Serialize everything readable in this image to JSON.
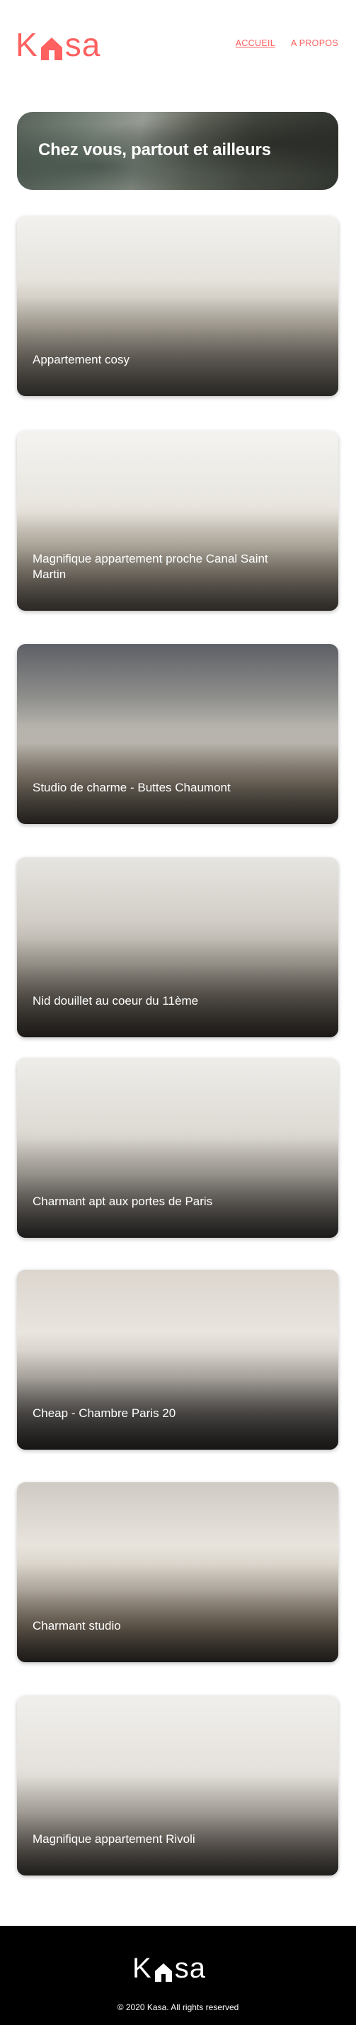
{
  "brand": {
    "name_start": "K",
    "name_end": "sa",
    "color": "#FF6060"
  },
  "nav": [
    {
      "label": "ACCUEIL",
      "active": true
    },
    {
      "label": "A PROPOS",
      "active": false
    }
  ],
  "banner": {
    "title": "Chez vous, partout et ailleurs"
  },
  "listings": [
    {
      "title": "Appartement cosy"
    },
    {
      "title": "Magnifique appartement proche Canal Saint Martin"
    },
    {
      "title": "Studio de charme - Buttes Chaumont"
    },
    {
      "title": "Nid douillet au coeur du 11ème"
    },
    {
      "title": "Charmant apt aux portes de Paris"
    },
    {
      "title": "Cheap - Chambre Paris 20"
    },
    {
      "title": "Charmant studio"
    },
    {
      "title": "Magnifique appartement Rivoli"
    }
  ],
  "footer": {
    "brand_start": "K",
    "brand_end": "sa",
    "copyright": "© 2020 Kasa. All rights reserved"
  }
}
